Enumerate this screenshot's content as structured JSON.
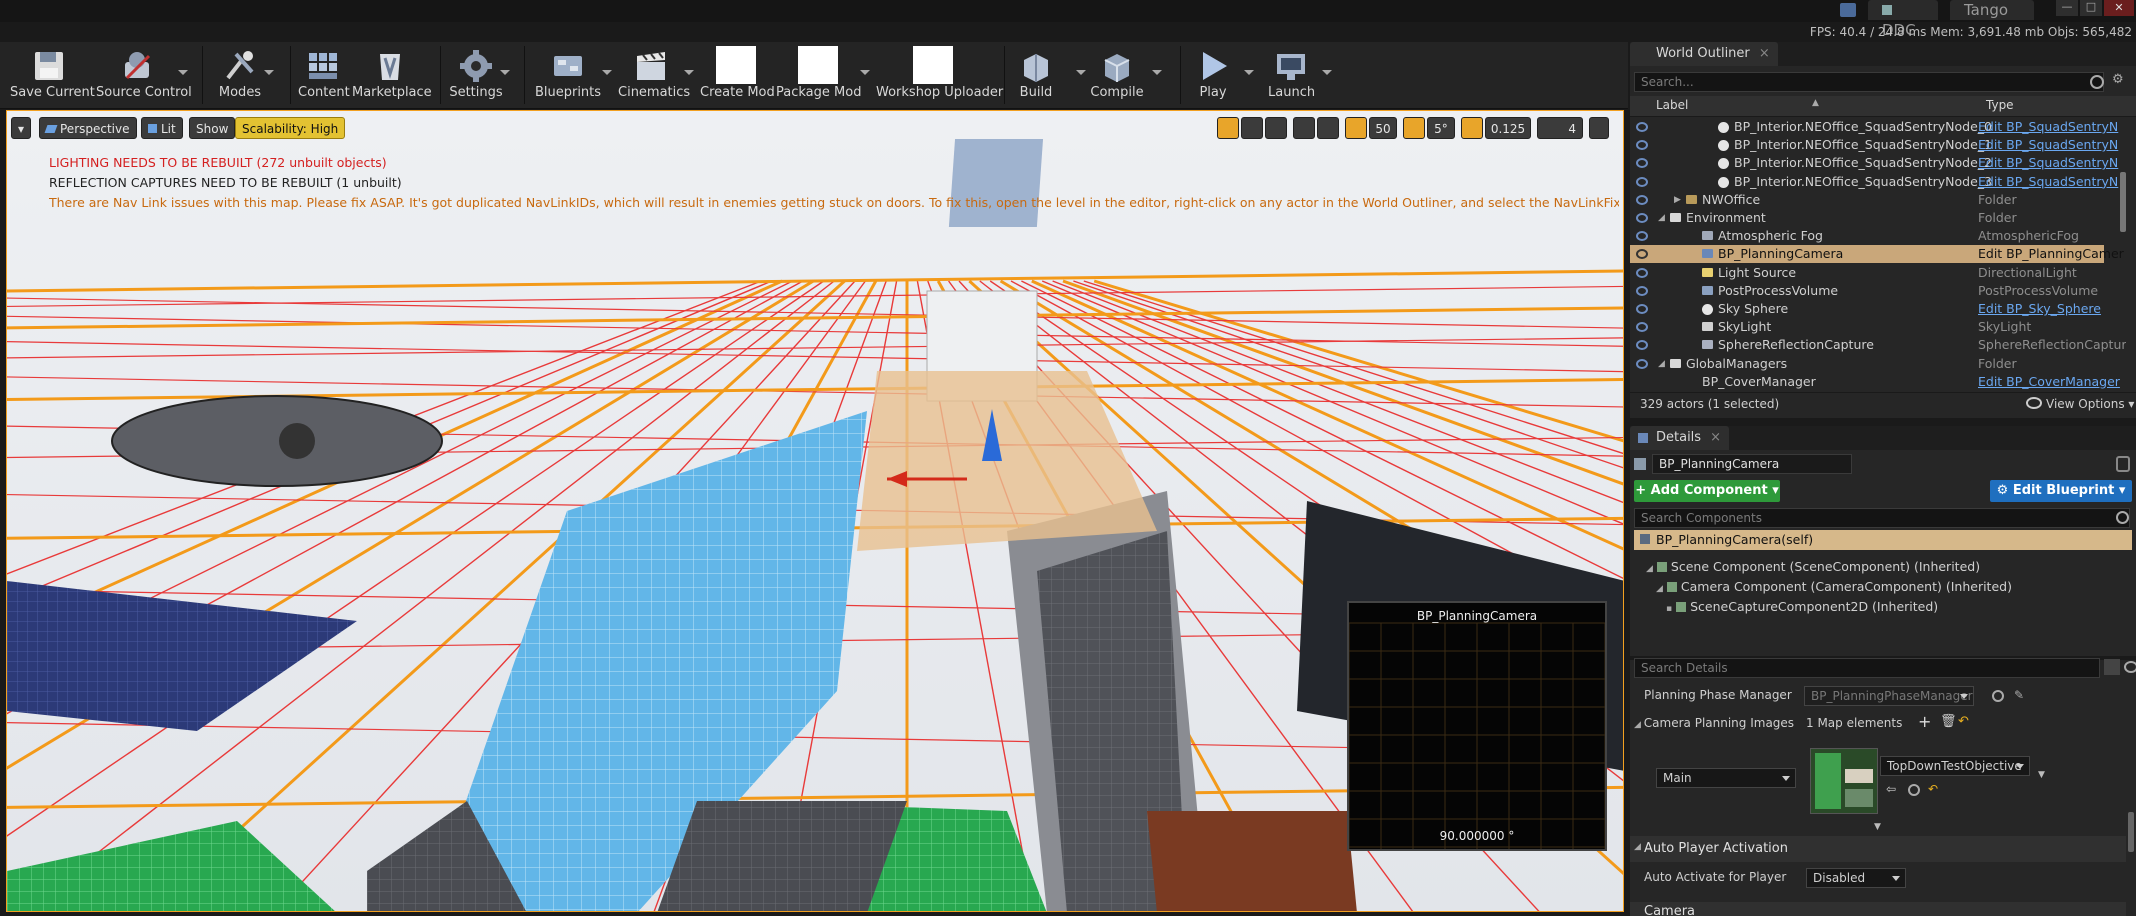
{
  "titlebar": {
    "tabs": [
      "DDC",
      "Tango"
    ]
  },
  "stats": {
    "text": "FPS: 40.4    /  24.8 ms   Mem: 3,691.48 mb   Objs: 565,482"
  },
  "toolbar": {
    "buttons": [
      {
        "label": "Save Current",
        "icon": "save-icon"
      },
      {
        "label": "Source Control",
        "icon": "source-control-icon"
      },
      {
        "label": "Modes",
        "icon": "modes-icon"
      },
      {
        "label": "Content",
        "icon": "content-icon"
      },
      {
        "label": "Marketplace",
        "icon": "marketplace-icon"
      },
      {
        "label": "Settings",
        "icon": "gear-icon"
      },
      {
        "label": "Blueprints",
        "icon": "blueprints-icon"
      },
      {
        "label": "Cinematics",
        "icon": "cinematics-icon"
      },
      {
        "label": "Create Mod",
        "icon": "blank-icon"
      },
      {
        "label": "Package Mod",
        "icon": "blank-icon"
      },
      {
        "label": "Workshop Uploader",
        "icon": "blank-icon"
      },
      {
        "label": "Build",
        "icon": "build-icon"
      },
      {
        "label": "Compile",
        "icon": "compile-icon"
      },
      {
        "label": "Play",
        "icon": "play-icon"
      },
      {
        "label": "Launch",
        "icon": "launch-icon"
      }
    ]
  },
  "viewport": {
    "view_mode": "Perspective",
    "lit": "Lit",
    "show": "Show",
    "scalability": "Scalability: High",
    "snap_grid": "50",
    "snap_angle": "5°",
    "snap_scale": "0.125",
    "camera_speed": "4",
    "warnings": [
      {
        "text": "LIGHTING NEEDS TO BE REBUILT (272 unbuilt objects)",
        "color": "#d42020"
      },
      {
        "text": "REFLECTION CAPTURES NEED TO BE REBUILT (1 unbuilt)",
        "color": "#222222"
      },
      {
        "text": "There are Nav Link issues with this map. Please fix ASAP. It's got duplicated NavLinkIDs, which will result in enemies getting stuck on doors. To fix this, open the level in the editor, right-click on any actor in the World Outliner, and select the NavLinkFix_UpdateNavLinkIDs option",
        "color": "#c86a10"
      }
    ],
    "preview": {
      "title": "BP_PlanningCamera",
      "value": "90.000000 °"
    }
  },
  "outliner": {
    "title": "World Outliner",
    "search_placeholder": "Search...",
    "col_label": "Label",
    "col_type": "Type",
    "rows": [
      {
        "label": "BP_Interior.NEOffice_SquadSentryNode_0",
        "type": "Edit BP_SquadSentryN",
        "link": true,
        "indent": 3,
        "icon": "sphere-icon"
      },
      {
        "label": "BP_Interior.NEOffice_SquadSentryNode_1",
        "type": "Edit BP_SquadSentryN",
        "link": true,
        "indent": 3,
        "icon": "sphere-icon"
      },
      {
        "label": "BP_Interior.NEOffice_SquadSentryNode_2",
        "type": "Edit BP_SquadSentryN",
        "link": true,
        "indent": 3,
        "icon": "sphere-icon"
      },
      {
        "label": "BP_Interior.NEOffice_SquadSentryNode_3",
        "type": "Edit BP_SquadSentryN",
        "link": true,
        "indent": 3,
        "icon": "sphere-icon"
      },
      {
        "label": "NWOffice",
        "type": "Folder",
        "link": false,
        "indent": 1,
        "icon": "folder-icon"
      },
      {
        "label": "Environment",
        "type": "Folder",
        "link": false,
        "indent": 0,
        "icon": "folder-open-icon"
      },
      {
        "label": "Atmospheric Fog",
        "type": "AtmosphericFog",
        "link": false,
        "indent": 2,
        "icon": "fog-icon"
      },
      {
        "label": "BP_PlanningCamera",
        "type": "Edit BP_PlanningCamer",
        "link": true,
        "indent": 2,
        "icon": "camera-icon",
        "selected": true
      },
      {
        "label": "Light Source",
        "type": "DirectionalLight",
        "link": false,
        "indent": 2,
        "icon": "light-icon"
      },
      {
        "label": "PostProcessVolume",
        "type": "PostProcessVolume",
        "link": false,
        "indent": 2,
        "icon": "volume-icon"
      },
      {
        "label": "Sky Sphere",
        "type": "Edit BP_Sky_Sphere",
        "link": true,
        "indent": 2,
        "icon": "sphere-icon"
      },
      {
        "label": "SkyLight",
        "type": "SkyLight",
        "link": false,
        "indent": 2,
        "icon": "skylight-icon"
      },
      {
        "label": "SphereReflectionCapture",
        "type": "SphereReflectionCapture",
        "link": false,
        "indent": 2,
        "icon": "reflection-icon"
      },
      {
        "label": "GlobalManagers",
        "type": "Folder",
        "link": false,
        "indent": 0,
        "icon": "folder-open-icon"
      }
    ],
    "cut_row": {
      "label": "BP_CoverManager",
      "type": "Edit BP_CoverManager"
    },
    "footer": "329 actors (1 selected)",
    "view_options": "View Options"
  },
  "details": {
    "title": "Details",
    "actor_name": "BP_PlanningCamera",
    "add_component": "+ Add Component",
    "edit_blueprint": "Edit Blueprint",
    "search_components": "Search Components",
    "self_label": "BP_PlanningCamera(self)",
    "components": [
      {
        "label": "Scene Component (SceneComponent) (Inherited)",
        "indent": 0
      },
      {
        "label": "Camera Component (CameraComponent) (Inherited)",
        "indent": 1
      },
      {
        "label": "SceneCaptureComponent2D (Inherited)",
        "indent": 2
      }
    ],
    "search_details": "Search Details",
    "planning_phase_manager_label": "Planning Phase Manager",
    "planning_phase_manager_value": "BP_PlanningPhaseManager",
    "camera_planning_images_label": "Camera Planning Images",
    "map_elements": "1 Map elements",
    "key_value": "Main",
    "objective_value": "TopDownTestObjective",
    "auto_player_activation": "Auto Player Activation",
    "auto_activate_label": "Auto Activate for Player",
    "auto_activate_value": "Disabled",
    "camera_section": "Camera"
  }
}
